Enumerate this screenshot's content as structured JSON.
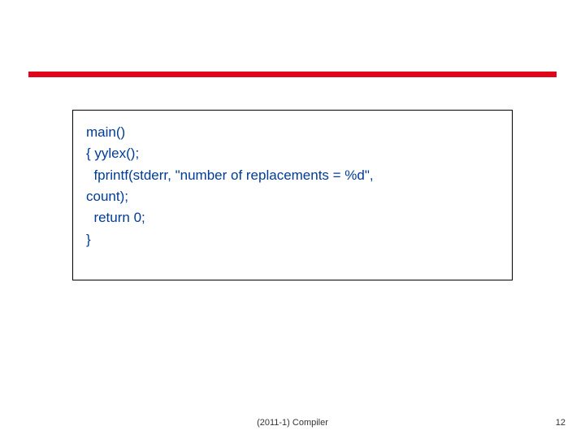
{
  "code": {
    "l1": "main()",
    "l2": "{ yylex();",
    "l3": "  fprintf(stderr, \"number of replacements = %d\",",
    "l4": "count);",
    "l5": "  return 0;",
    "l6": "}"
  },
  "footer": {
    "center": "(2011-1) Compiler",
    "page": "12"
  },
  "colors": {
    "accent": "#e2041b",
    "codeText": "#003c95"
  }
}
